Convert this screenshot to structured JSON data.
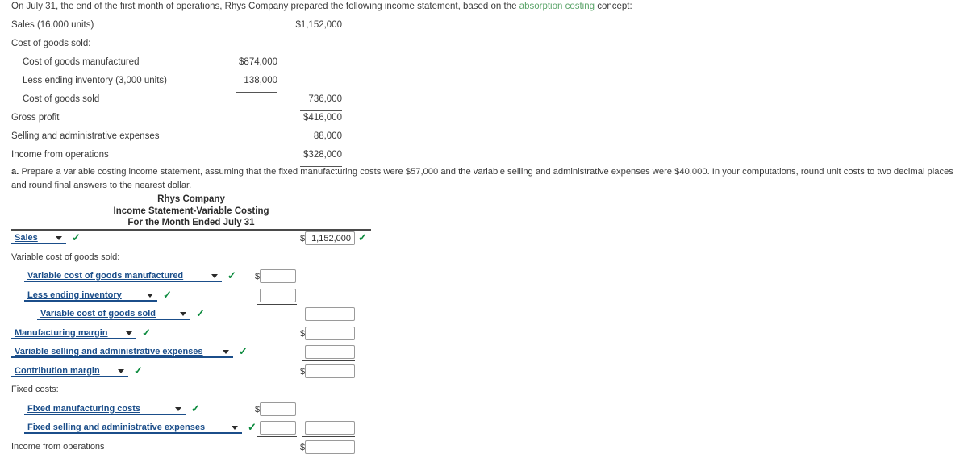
{
  "intro": {
    "before": "On July 31, the end of the first month of operations, Rhys Company prepared the following income statement, based on the ",
    "link": "absorption costing",
    "after": " concept:"
  },
  "given_statement": {
    "rows": [
      {
        "label": "Sales (16,000 units)",
        "indent": 0,
        "col1": "",
        "col2": "$1,152,000"
      },
      {
        "label": "Cost of goods sold:",
        "indent": 0,
        "col1": "",
        "col2": ""
      },
      {
        "label": "Cost of goods manufactured",
        "indent": 1,
        "col1": "$874,000",
        "col2": ""
      },
      {
        "label": "Less ending inventory (3,000 units)",
        "indent": 1,
        "col1": "138,000",
        "col2": ""
      },
      {
        "label": "Cost of goods sold",
        "indent": 1,
        "col1": "",
        "col2": "736,000"
      },
      {
        "label": "Gross profit",
        "indent": 0,
        "col1": "",
        "col2": "$416,000"
      },
      {
        "label": "Selling and administrative expenses",
        "indent": 0,
        "col1": "",
        "col2": "88,000"
      },
      {
        "label": "Income from operations",
        "indent": 0,
        "col1": "",
        "col2": "$328,000"
      }
    ]
  },
  "question": {
    "marker": "a.",
    "text": "Prepare a variable costing income statement, assuming that the fixed manufacturing costs were $57,000 and the variable selling and administrative expenses were $40,000. In your computations, round unit costs to two decimal places and round final answers to the nearest dollar."
  },
  "worksheet": {
    "title_line1": "Rhys Company",
    "title_line2": "Income Statement-Variable Costing",
    "title_line3": "For the Month Ended July 31",
    "check_mark": "✓",
    "dollar_sign": "$",
    "rows": [
      {
        "kind": "select",
        "label": "Sales",
        "indent": 0,
        "sel_width": 68,
        "checked": true,
        "amount_col": 2,
        "amount_value": "1,152,000",
        "amount_dollar": true,
        "amount_ok": true
      },
      {
        "kind": "text",
        "label": "Variable cost of goods sold:",
        "indent": 0
      },
      {
        "kind": "select",
        "label": "Variable cost of goods manufactured",
        "indent": 1,
        "sel_width": 245,
        "checked": true,
        "amount_col": 1,
        "amount_value": "",
        "amount_dollar": true,
        "amount_ok": false
      },
      {
        "kind": "select",
        "label": "Less ending inventory",
        "indent": 1,
        "sel_width": 165,
        "checked": true,
        "amount_col": 1,
        "amount_value": "",
        "amount_dollar": false,
        "amount_ok": false,
        "rule_after_col1": true
      },
      {
        "kind": "select",
        "label": "Variable cost of goods sold",
        "indent": 2,
        "sel_width": 190,
        "checked": true,
        "amount_col": 2,
        "amount_value": "",
        "amount_dollar": false,
        "amount_ok": false,
        "rule_after_col2": true
      },
      {
        "kind": "select",
        "label": "Manufacturing margin",
        "indent": 0,
        "sel_width": 155,
        "checked": true,
        "amount_col": 2,
        "amount_value": "",
        "amount_dollar": true,
        "amount_ok": false
      },
      {
        "kind": "select",
        "label": "Variable selling and administrative expenses",
        "indent": 0,
        "sel_width": 275,
        "checked": true,
        "amount_col": 2,
        "amount_value": "",
        "amount_dollar": false,
        "amount_ok": false,
        "rule_after_col2": true
      },
      {
        "kind": "select",
        "label": "Contribution margin",
        "indent": 0,
        "sel_width": 145,
        "checked": true,
        "amount_col": 2,
        "amount_value": "",
        "amount_dollar": true,
        "amount_ok": false
      },
      {
        "kind": "text",
        "label": "Fixed costs:",
        "indent": 0
      },
      {
        "kind": "select",
        "label": "Fixed manufacturing costs",
        "indent": 1,
        "sel_width": 200,
        "checked": true,
        "amount_col": 1,
        "amount_value": "",
        "amount_dollar": true,
        "amount_ok": false
      },
      {
        "kind": "select",
        "label": "Fixed selling and administrative expenses",
        "indent": 1,
        "sel_width": 270,
        "checked": true,
        "amount_col": "both",
        "amount_value": "",
        "amount_dollar": false,
        "amount_ok": false,
        "rule_after_col1": true,
        "rule_after_col2": true
      },
      {
        "kind": "text",
        "label": "Income from operations",
        "indent": 0,
        "amount_col": 2,
        "amount_value": "",
        "amount_dollar": true
      }
    ]
  },
  "colors": {
    "link_green": "#5aa469",
    "select_blue": "#1b4e8a",
    "check_green": "#0b8a3d",
    "text": "#3a3a3a"
  }
}
